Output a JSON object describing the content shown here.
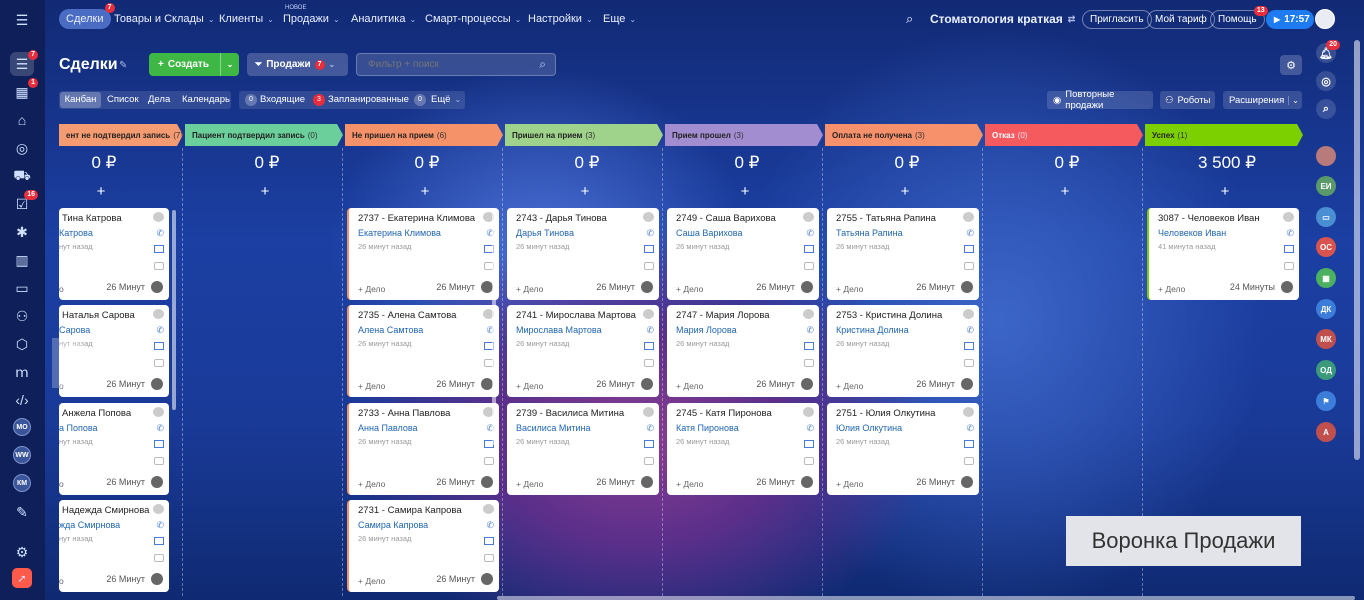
{
  "topbar": {
    "tabs": [
      {
        "label": "Сделки",
        "badge": "7"
      },
      {
        "label": "Товары и Склады"
      },
      {
        "label": "Клиенты"
      },
      {
        "label": "Продажи",
        "note": "НОВОЕ"
      },
      {
        "label": "Аналитика"
      },
      {
        "label": "Смарт-процессы"
      },
      {
        "label": "Настройки"
      },
      {
        "label": "Еще"
      }
    ],
    "company": "Стоматология краткая",
    "invite": "Пригласить",
    "tariff": "Мой тариф",
    "help": "Помощь",
    "help_badge": "13",
    "time": "17:57"
  },
  "sidebar": {
    "badges": {
      "deals": "7",
      "second": "1",
      "tasks": "16"
    },
    "users": [
      "МО",
      "WW",
      "КМ"
    ]
  },
  "toolbar": {
    "title": "Сделки",
    "create": "Создать",
    "funnel": "Продажи",
    "funnel_badge": "7",
    "filter_placeholder": "Фильтр + поиск"
  },
  "views": [
    "Канбан",
    "Список",
    "Дела",
    "Календарь"
  ],
  "counters": {
    "incoming_count": "0",
    "incoming": "Входящие",
    "planned_count": "3",
    "planned": "Запланированные",
    "more_count": "0",
    "more": "Ещё"
  },
  "actions": {
    "repeat": "Повторные продажи",
    "robots": "Роботы",
    "extension": "Расширения"
  },
  "right_panel": {
    "bell_badge": "20",
    "avatars": [
      "ЕИ",
      "ОС",
      "ДК",
      "МК",
      "ОД",
      "А"
    ]
  },
  "columns": [
    {
      "title": "ент не подтвердил запись",
      "count": "(7)",
      "color": "#f49b71",
      "sum": "0 ₽"
    },
    {
      "title": "Пациент подтвердил запись",
      "count": "(0)",
      "color": "#6bcf9b",
      "sum": "0 ₽"
    },
    {
      "title": "Не пришел на прием",
      "count": "(6)",
      "color": "#f59269",
      "sum": "0 ₽"
    },
    {
      "title": "Пришел на прием",
      "count": "(3)",
      "color": "#9fd38b",
      "sum": "0 ₽"
    },
    {
      "title": "Прием прошел",
      "count": "(3)",
      "color": "#a38dd1",
      "sum": "0 ₽"
    },
    {
      "title": "Оплата не получена",
      "count": "(3)",
      "color": "#f7916c",
      "sum": "0 ₽"
    },
    {
      "title": "Отказ",
      "count": "(0)",
      "color": "#f55a5f",
      "sum": "0 ₽"
    },
    {
      "title": "Успех",
      "count": "(1)",
      "color": "#7dd000",
      "sum": "3 500 ₽"
    }
  ],
  "cards": [
    {
      "col": 0,
      "row": 0,
      "title": "Тина Катрова",
      "contact": "Катрова",
      "meta": "нут назад",
      "act": "о",
      "time": "26 Минут"
    },
    {
      "col": 0,
      "row": 1,
      "title": "Наталья Сарова",
      "contact": "Сарова",
      "meta": "нут назад",
      "act": "о",
      "time": "26 Минут"
    },
    {
      "col": 0,
      "row": 2,
      "title": "Анжела Попова",
      "contact": "а Попова",
      "meta": "нут назад",
      "act": "о",
      "time": "26 Минут"
    },
    {
      "col": 0,
      "row": 3,
      "title": "Надежда Смирнова",
      "contact": "жда Смирнова",
      "meta": "нут назад",
      "act": "о",
      "time": "26 Минут"
    },
    {
      "col": 2,
      "row": 0,
      "title": "2737 - Екатерина Климова",
      "contact": "Екатерина Климова",
      "meta": "26 минут назад",
      "act": "+ Дело",
      "time": "26 Минут"
    },
    {
      "col": 2,
      "row": 1,
      "title": "2735 - Алена Самтова",
      "contact": "Алена Самтова",
      "meta": "26 минут назад",
      "act": "+ Дело",
      "time": "26 Минут"
    },
    {
      "col": 2,
      "row": 2,
      "title": "2733 - Анна Павлова",
      "contact": "Анна Павлова",
      "meta": "26 минут назад",
      "act": "+ Дело",
      "time": "26 Минут"
    },
    {
      "col": 2,
      "row": 3,
      "title": "2731 - Самира Капрова",
      "contact": "Самира Капрова",
      "meta": "26 минут назад",
      "act": "+ Дело",
      "time": "26 Минут"
    },
    {
      "col": 3,
      "row": 0,
      "title": "2743 - Дарья Тинова",
      "contact": "Дарья Тинова",
      "meta": "26 минут назад",
      "act": "+ Дело",
      "time": "26 Минут"
    },
    {
      "col": 3,
      "row": 1,
      "title": "2741 - Мирослава Мартова",
      "contact": "Мирослава Мартова",
      "meta": "26 минут назад",
      "act": "+ Дело",
      "time": "26 Минут"
    },
    {
      "col": 3,
      "row": 2,
      "title": "2739 - Василиса Митина",
      "contact": "Василиса Митина",
      "meta": "26 минут назад",
      "act": "+ Дело",
      "time": "26 Минут"
    },
    {
      "col": 4,
      "row": 0,
      "title": "2749 - Саша Варихова",
      "contact": "Саша Варихова",
      "meta": "26 минут назад",
      "act": "+ Дело",
      "time": "26 Минут"
    },
    {
      "col": 4,
      "row": 1,
      "title": "2747 - Мария Лорова",
      "contact": "Мария Лорова",
      "meta": "26 минут назад",
      "act": "+ Дело",
      "time": "26 Минут"
    },
    {
      "col": 4,
      "row": 2,
      "title": "2745 - Катя Пиронова",
      "contact": "Катя Пиронова",
      "meta": "26 минут назад",
      "act": "+ Дело",
      "time": "26 Минут"
    },
    {
      "col": 5,
      "row": 0,
      "title": "2755 - Татьяна Рапина",
      "contact": "Татьяна Рапина",
      "meta": "26 минут назад",
      "act": "+ Дело",
      "time": "26 Минут"
    },
    {
      "col": 5,
      "row": 1,
      "title": "2753 - Кристина Долина",
      "contact": "Кристина Долина",
      "meta": "26 минут назад",
      "act": "+ Дело",
      "time": "26 Минут"
    },
    {
      "col": 5,
      "row": 2,
      "title": "2751 - Юлия Олкутина",
      "contact": "Юлия Олкутина",
      "meta": "26 минут назад",
      "act": "+ Дело",
      "time": "26 Минут"
    },
    {
      "col": 7,
      "row": 0,
      "title": "3087 - Человеков Иван",
      "contact": "Человеков Иван",
      "meta": "41 минута назад",
      "act": "+ Дело",
      "time": "24 Минуты"
    }
  ],
  "watermark": "Воронка Продажи"
}
